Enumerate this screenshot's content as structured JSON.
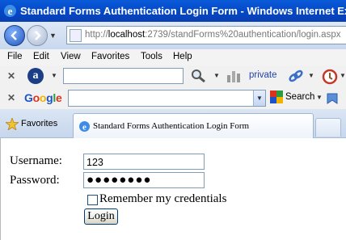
{
  "window": {
    "title": "Standard Forms Authentication Login Form - Windows Internet Ex"
  },
  "address_bar": {
    "url_prefix": "http://",
    "url_host": "localhost",
    "url_rest": ":2739/standForms%20authentication/login.aspx"
  },
  "menu": {
    "items": [
      "File",
      "Edit",
      "View",
      "Favorites",
      "Tools",
      "Help"
    ]
  },
  "ask_toolbar": {
    "private_label": "private"
  },
  "google_toolbar": {
    "logo": "Google",
    "search_label": "Search"
  },
  "tabs": {
    "favorites_label": "Favorites",
    "active_tab_label": "Standard Forms Authentication Login Form"
  },
  "login_form": {
    "username_label": "Username:",
    "username_value": "123",
    "password_label": "Password:",
    "password_value": "●●●●●●●●",
    "remember_label": "Remember my credentials",
    "login_button": "Login"
  },
  "colors": {
    "title_bar": "#0447c7",
    "google_blue": "#1a53c8",
    "google_red": "#d9321e",
    "google_yellow": "#f0b400",
    "google_green": "#2a9b3e"
  }
}
